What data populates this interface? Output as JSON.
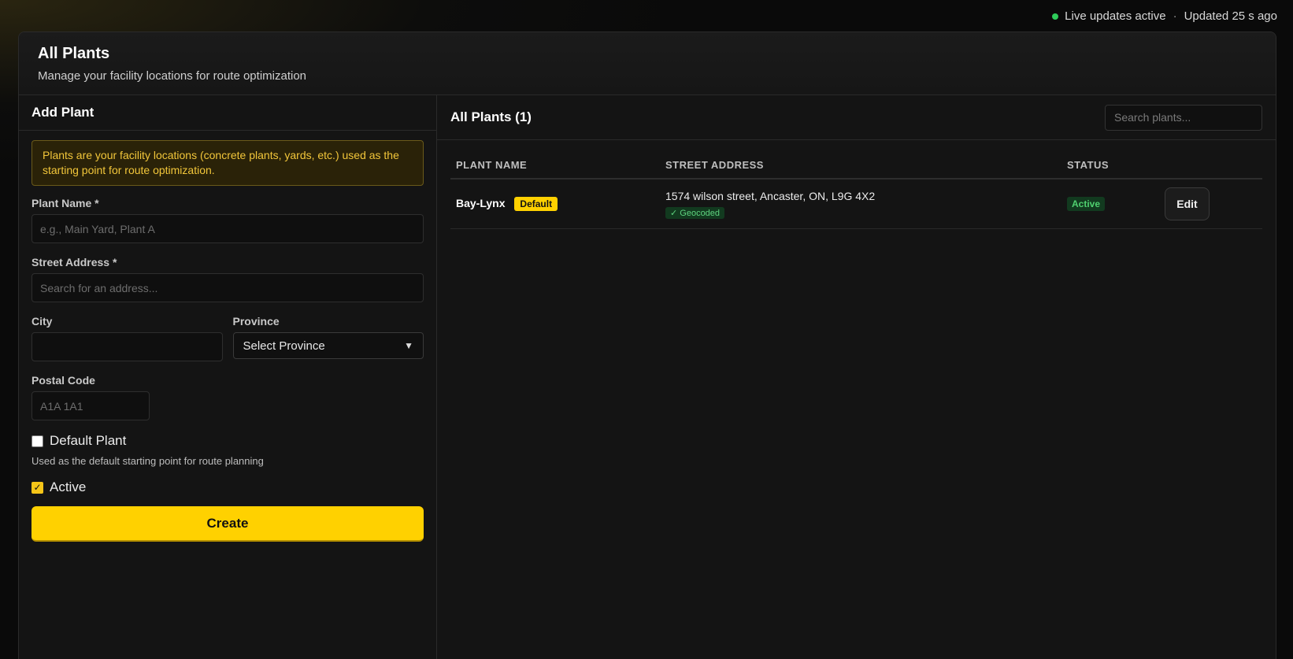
{
  "status": {
    "live_text": "Live updates active",
    "separator": "·",
    "updated_text": "Updated 25 s ago",
    "dot_color": "#2ecc5a"
  },
  "header": {
    "title": "All Plants",
    "subtitle": "Manage your facility locations for route optimization"
  },
  "form": {
    "title": "Add Plant",
    "notice": "Plants are your facility locations (concrete plants, yards, etc.) used as the starting point for route optimization.",
    "plant_name_label": "Plant Name *",
    "plant_name_placeholder": "e.g., Main Yard, Plant A",
    "street_label": "Street Address *",
    "street_placeholder": "Search for an address...",
    "city_label": "City",
    "city_value": "",
    "province_label": "Province",
    "province_selected": "Select Province",
    "postal_label": "Postal Code",
    "postal_placeholder": "A1A 1A1",
    "default_label": "Default Plant",
    "default_checked": false,
    "default_hint": "Used as the default starting point for route planning",
    "active_label": "Active",
    "active_checked": true,
    "create_label": "Create",
    "accent_color": "#ffd100"
  },
  "list": {
    "title": "All Plants (1)",
    "search_placeholder": "Search plants...",
    "columns": [
      "PLANT NAME",
      "STREET ADDRESS",
      "STATUS"
    ],
    "rows": [
      {
        "name": "Bay-Lynx",
        "default_badge": "Default",
        "address": "1574 wilson street, Ancaster, ON, L9G 4X2",
        "geocoded_badge": "✓ Geocoded",
        "status": "Active",
        "action": "Edit"
      }
    ]
  }
}
